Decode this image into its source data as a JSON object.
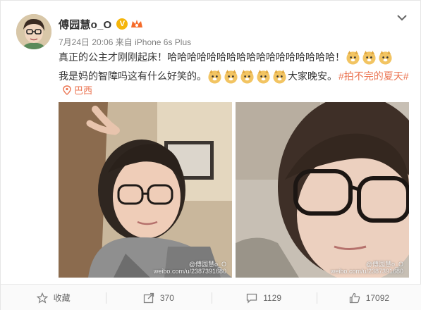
{
  "post": {
    "username": "傅园慧o_O",
    "vip_badge": "V",
    "timestamp": "7月24日 20:06",
    "source_prefix": "来自",
    "source_device": "iPhone 6s Plus",
    "text_line1": "真正的公主才刚刚起床！哈哈哈哈哈哈哈哈哈哈哈哈哈哈哈哈哈！",
    "text_line2_before": "我是妈的智障吗这有什么好笑的。",
    "text_line2_after": "大家晚安。",
    "hashtag": "#拍不完的夏天#",
    "location": "巴西",
    "watermark_line1": "@傅园慧o_O",
    "watermark_line2": "weibo.com/u/2387391680",
    "emoji": "doge-emoji",
    "accent_color": "#eb7350"
  },
  "actions": {
    "favorite": "收藏",
    "repost": "370",
    "comment": "1129",
    "like": "17092"
  }
}
